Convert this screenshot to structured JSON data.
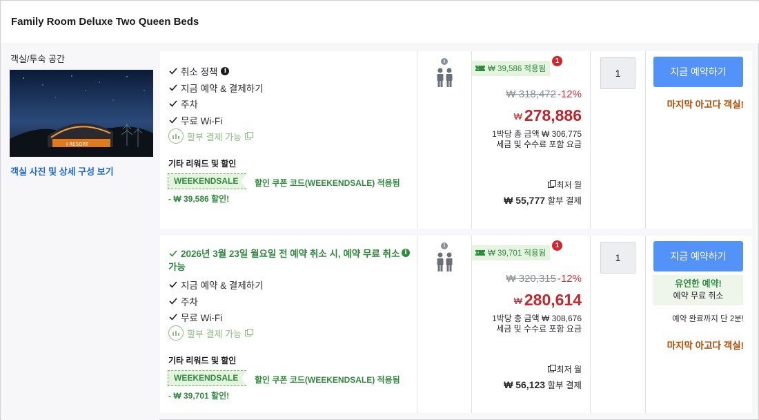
{
  "room": {
    "title": "Family Room Deluxe Two Queen Beds",
    "type_label": "객실/투숙 공간",
    "photo_link": "객실 사진 및 상세 구성 보기",
    "photo_sign": "I RESORT"
  },
  "offers": [
    {
      "benefits": [
        "취소 정책",
        "지금 예약 & 결제하기",
        "주차",
        "무료 Wi-Fi"
      ],
      "installment": "할부 결제 가능",
      "other_title": "기타 리워드 및 할인",
      "coupon_code": "WEEKENDSALE",
      "coupon_text": "할인 쿠폰 코드(WEEKENDSALE) 적용됨",
      "discount_text": "- ₩ 39,586 할인!",
      "applied_tag": "₩ 39,586 적용됨",
      "badge": "1",
      "orig_price": "₩ 318,472",
      "pct": "-12%",
      "currency": "₩",
      "final_price": "278,886",
      "per_night": "1박당 총 금액 ₩ 306,775",
      "tax_note": "세금 및 수수료 포함 요금",
      "lowest_label": "최저 월",
      "monthly_amount": "₩ 55,777",
      "monthly_suffix": "할부 결제",
      "qty": "1",
      "book_label": "지금 예약하기",
      "last_room": "마지막 아고다 객실!"
    },
    {
      "free_cancel": "2026년 3월 23일 월요일 전 예약 취소 시, 예약 무료 취소 가능",
      "benefits": [
        "지금 예약 & 결제하기",
        "주차",
        "무료 Wi-Fi"
      ],
      "installment": "할부 결제 가능",
      "other_title": "기타 리워드 및 할인",
      "coupon_code": "WEEKENDSALE",
      "coupon_text": "할인 쿠폰 코드(WEEKENDSALE) 적용됨",
      "discount_text": "- ₩ 39,701 할인!",
      "applied_tag": "₩ 39,701 적용됨",
      "badge": "1",
      "orig_price": "₩ 320,315",
      "pct": "-12%",
      "currency": "₩",
      "final_price": "280,614",
      "per_night": "1박당 총 금액 ₩ 308,676",
      "tax_note": "세금 및 수수료 포함 요금",
      "lowest_label": "최저 월",
      "monthly_amount": "₩ 56,123",
      "monthly_suffix": "할부 결제",
      "qty": "1",
      "book_label": "지금 예약하기",
      "flex_title": "유연한 예약!",
      "flex_sub": "예약 무료 취소",
      "steps_left": "예약 완료까지 단 2분!",
      "last_room": "마지막 아고다 객실!"
    }
  ],
  "colors": {
    "accent": "#5392f9",
    "green": "#2f8a3e",
    "red": "#c1272d",
    "orange": "#b84a00"
  },
  "icons": [
    "check-icon",
    "info-icon",
    "installment-icon",
    "external-link-icon",
    "ticket-icon",
    "person-icon"
  ]
}
